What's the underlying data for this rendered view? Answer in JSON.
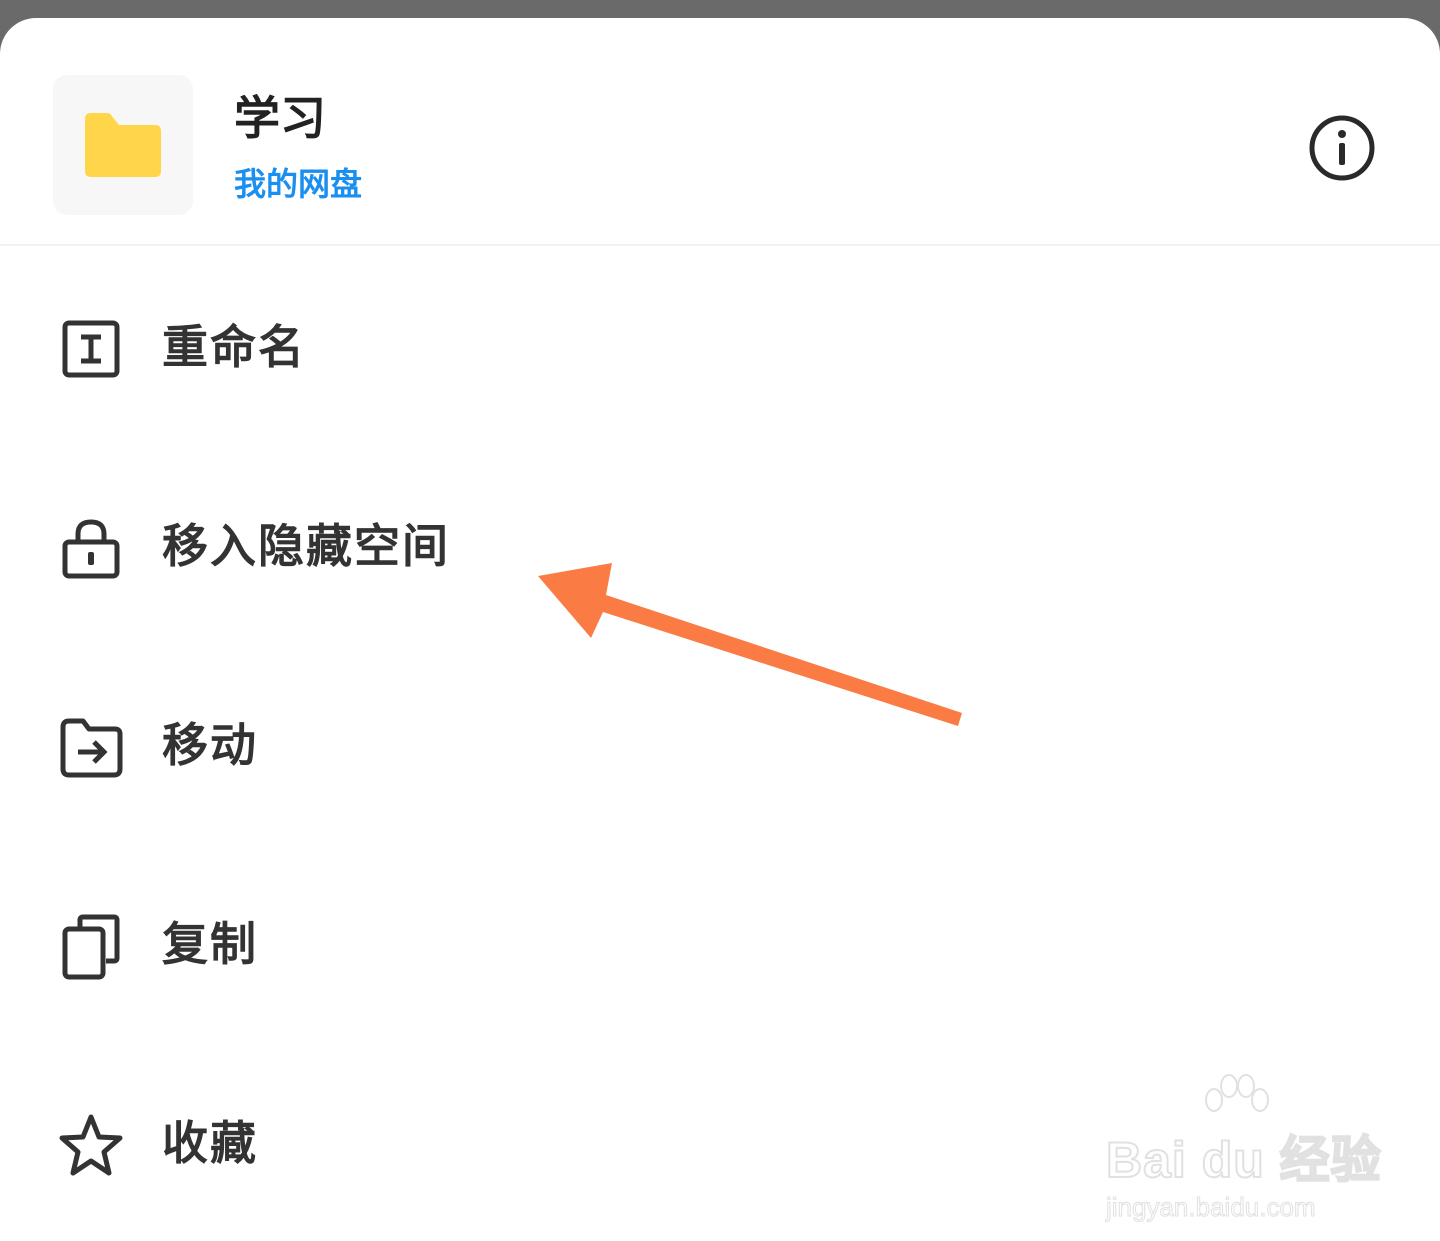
{
  "colors": {
    "accent": "#1a8ff0",
    "folder": "#ffd54a",
    "annotation_arrow": "#fb7b45",
    "text": "#333333"
  },
  "header": {
    "title": "学习",
    "location": "我的网盘",
    "thumbnail_icon": "folder-icon",
    "info_icon": "info-icon"
  },
  "menu": [
    {
      "label": "重命名",
      "icon": "rename-icon"
    },
    {
      "label": "移入隐藏空间",
      "icon": "lock-icon"
    },
    {
      "label": "移动",
      "icon": "move-folder-icon"
    },
    {
      "label": "复制",
      "icon": "copy-icon"
    },
    {
      "label": "收藏",
      "icon": "star-icon"
    }
  ],
  "watermark": {
    "brand": "Bai du 经验",
    "url": "jingyan.baidu.com"
  }
}
